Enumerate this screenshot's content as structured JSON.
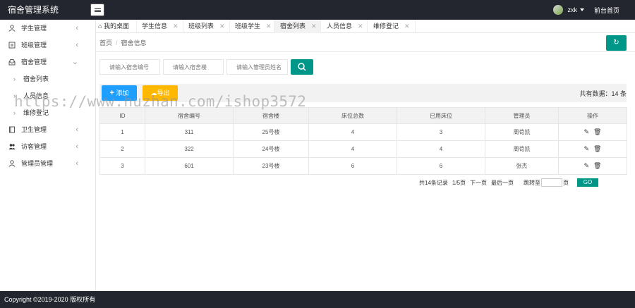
{
  "header": {
    "title": "宿舍管理系统",
    "user": "zxk",
    "front_link": "前台首页"
  },
  "sidebar": {
    "items": [
      {
        "label": "学生管理",
        "icon": "user-icon"
      },
      {
        "label": "班级管理",
        "icon": "class-icon"
      },
      {
        "label": "宿舍管理",
        "icon": "inbox-icon",
        "expanded": true,
        "children": [
          "宿舍列表",
          "人员信息",
          "维修登记"
        ]
      },
      {
        "label": "卫生管理",
        "icon": "book-icon"
      },
      {
        "label": "访客管理",
        "icon": "users-icon"
      },
      {
        "label": "管理员管理",
        "icon": "admin-icon"
      }
    ]
  },
  "tabs": [
    {
      "label": "我的桌面",
      "icon": "home-icon",
      "closable": false
    },
    {
      "label": "学生信息",
      "closable": true
    },
    {
      "label": "班级列表",
      "closable": true
    },
    {
      "label": "班级学生",
      "closable": true
    },
    {
      "label": "宿舍列表",
      "closable": true,
      "active": true
    },
    {
      "label": "人员信息",
      "closable": true
    },
    {
      "label": "维修登记",
      "closable": true
    }
  ],
  "breadcrumb": {
    "home": "首页",
    "current": "宿舍信息",
    "separator": "/"
  },
  "search": {
    "dorm_no_placeholder": "请输入宿舍编号",
    "building_placeholder": "请输入宿舍楼",
    "manager_placeholder": "请输入管理员姓名"
  },
  "toolbar": {
    "add_label": "添加",
    "export_label": "导出",
    "total_text": "共有数据：14 条"
  },
  "table": {
    "headers": [
      "ID",
      "宿舍编号",
      "宿舍楼",
      "床位总数",
      "已用床位",
      "管理员",
      "操作"
    ],
    "rows": [
      [
        "1",
        "311",
        "25号楼",
        "4",
        "3",
        "周苟凯"
      ],
      [
        "2",
        "322",
        "24号楼",
        "4",
        "4",
        "周苟凯"
      ],
      [
        "3",
        "601",
        "23号楼",
        "6",
        "6",
        "张杰"
      ]
    ]
  },
  "pager": {
    "records": "共14条记录",
    "page_info": "1/5页",
    "next": "下一页",
    "last": "最后一页",
    "jump_to": "跳转至",
    "page_suffix": "页",
    "go": "GO"
  },
  "watermark": "https://www.huzhan.com/ishop3572",
  "footer": {
    "copyright": "Copyright ©2019-2020 版权所有"
  },
  "colors": {
    "header_bg": "#23262e",
    "primary": "#009688",
    "add_btn": "#1e9fff",
    "export_btn": "#ffb800"
  }
}
